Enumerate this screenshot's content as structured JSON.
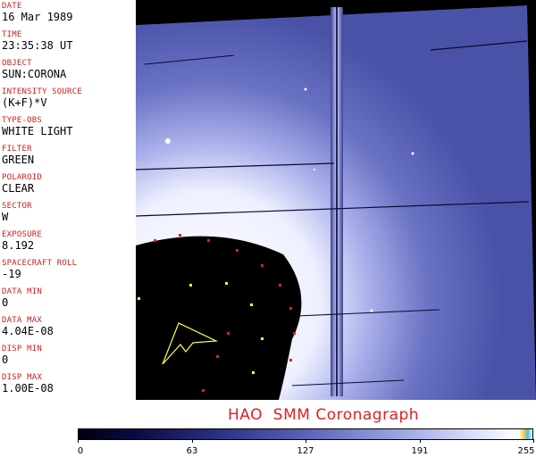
{
  "header_fields": [
    {
      "label": "DATE",
      "value": "16 Mar 1989"
    },
    {
      "label": "TIME",
      "value": "23:35:38 UT"
    },
    {
      "label": "OBJECT",
      "value": "SUN:CORONA"
    },
    {
      "label": "INTENSITY SOURCE",
      "value": "(K+F)*V"
    },
    {
      "label": "TYPE-OBS",
      "value": "WHITE LIGHT"
    },
    {
      "label": "FILTER",
      "value": "GREEN"
    },
    {
      "label": "POLAROID",
      "value": "CLEAR"
    },
    {
      "label": "SECTOR",
      "value": "W"
    },
    {
      "label": "EXPOSURE",
      "value": "8.192"
    },
    {
      "label": "SPACECRAFT ROLL",
      "value": "-19"
    },
    {
      "label": "DATA MIN",
      "value": "0"
    },
    {
      "label": "DATA MAX",
      "value": "4.04E-08"
    },
    {
      "label": "DISP MIN",
      "value": "0"
    },
    {
      "label": "DISP MAX",
      "value": "1.00E-08"
    }
  ],
  "caption": "HAO  SMM Coronagraph",
  "colorbar": {
    "min": 0,
    "max": 255,
    "tick_labels": [
      "0",
      "63",
      "127",
      "191",
      "255"
    ]
  },
  "colors": {
    "label_red": "#cc2020",
    "caption_red": "#e02020",
    "image_dark": "#0a0a28",
    "image_bright": "#e8ecff",
    "image_mid": "#5a62b8"
  }
}
